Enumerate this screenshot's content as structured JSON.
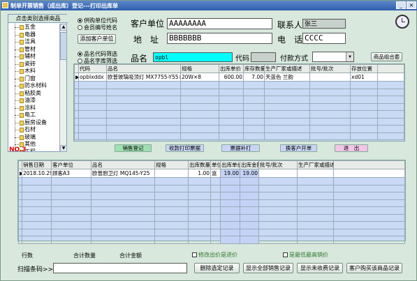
{
  "window": {
    "title": "制单开票销售（成出库）登记---打印出库单"
  },
  "category_panel": {
    "header": "点击类别选择商品",
    "items": [
      "五金",
      "电器",
      "洁具",
      "管材",
      "辅材",
      "瓷砖",
      "木料",
      "门窗",
      "防水材料",
      "粘胶类",
      "油漆",
      "涂料",
      "电工",
      "厨房设备",
      "石材",
      "玻璃",
      "其他",
      "工程"
    ],
    "count_label": "NO.3"
  },
  "customer_mode": {
    "options": [
      "供购单位代码",
      "会员编号姓名"
    ],
    "selected": 0
  },
  "add_customer_button": "添加客户单位",
  "customer": {
    "unit_label": "客户单位",
    "unit_value": "AAAAAAAA",
    "contact_label": "联系人",
    "contact_value": "张三",
    "address_label": "地　址",
    "address_value": "BBBBBBB",
    "phone_label": "电　话",
    "phone_value": "CCCC"
  },
  "product_mode": {
    "options": [
      "品名代码筛选",
      "品名字库筛选"
    ],
    "selected": 0
  },
  "product_search": {
    "name_label": "品名",
    "name_value": "opbl",
    "code_label": "代码",
    "code_value": "",
    "payment_label": "付款方式",
    "payment_value": ""
  },
  "combo_button": "商品组合套",
  "product_grid": {
    "headers": [
      "代码",
      "品名",
      "规格",
      "出库单价",
      "库存数量",
      "生产厂家或描述",
      "批号/批次",
      "存放位置"
    ],
    "rows": [
      [
        "opblxddx",
        "欧普玻璃吸顶灯 MX7755-Y55×3",
        "20W×8",
        "600.00",
        "7.00",
        "天蓝色 兰韵",
        "",
        "xd01"
      ]
    ]
  },
  "action_buttons": [
    "销售登记",
    "收款打印票据",
    "票据补打",
    "换客户开单",
    "退　出"
  ],
  "sales_grid": {
    "headers": [
      "销售日期",
      "客户单位",
      "品名",
      "规格",
      "出库数量",
      "单位",
      "出库单价",
      "出库金额",
      "批号/批次",
      "生产厂家或描述"
    ],
    "rows": [
      [
        "2018.10.29",
        "顾客A3",
        "欧普厨卫灯 MQ145-Y25",
        "",
        "1.00",
        "盒",
        "19.00",
        "19.00",
        "",
        ""
      ]
    ]
  },
  "footer": {
    "rows_label": "行数",
    "qty_label": "合计数量",
    "amount_label": "合计金额",
    "modify_label": "修改出价是进价",
    "low_price_label": "是最低最高销价"
  },
  "barcode": {
    "label": "扫描条码>>",
    "value": ""
  },
  "bottom_buttons": [
    "删除选定记录",
    "显示全部销售记录",
    "显示未收费记录",
    "客户购买该商品记录"
  ]
}
